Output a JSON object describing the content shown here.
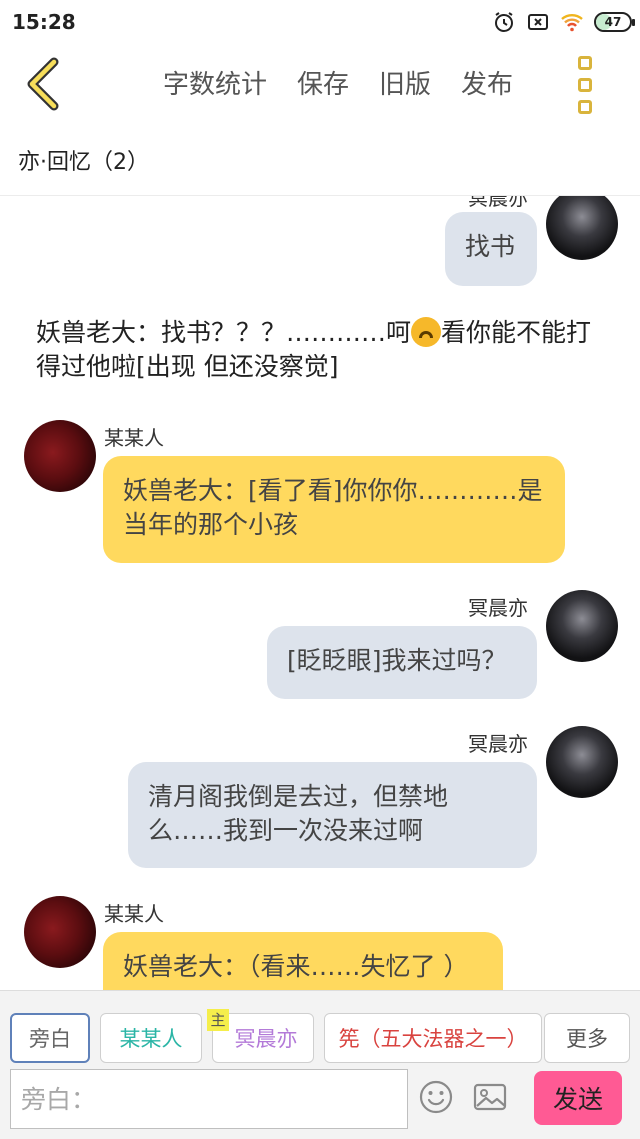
{
  "status_bar": {
    "time": "15:28",
    "battery": "47",
    "battery_level_percent": 47
  },
  "top_bar": {
    "menu": [
      "字数统计",
      "保存",
      "旧版",
      "发布"
    ]
  },
  "story_title": "亦·回忆（2）",
  "chat": {
    "partial_name_top": "冥晨亦",
    "msg1": "找书",
    "narration_part1": "妖兽老大：找书？？？…………呵",
    "narration_part2": "看你能不能打得过他啦[出现 但还没察觉]",
    "msg2_name": "某某人",
    "msg2": "妖兽老大：[看了看]你你你…………是当年的那个小孩",
    "msg3_name": "冥晨亦",
    "msg3": "[眨眨眼]我来过吗？",
    "msg4_name": "冥晨亦",
    "msg4": "清月阁我倒是去过，但禁地么……我到一次没来过啊",
    "msg5_name": "某某人",
    "msg5": "妖兽老大：（看来……失忆了 ）"
  },
  "roles": {
    "narrator": "旁白",
    "someone": "某某人",
    "main_badge": "主",
    "main": "冥晨亦",
    "other": "筅（五大法器之一）",
    "more": "更多"
  },
  "composer": {
    "placeholder": "旁白：",
    "send": "发送"
  },
  "colors": {
    "accent_yellow": "#ffd95e",
    "gray_bubble": "#dde3ec",
    "send_pink": "#ff5a94",
    "role_someone": "#2bb5a6",
    "role_main": "#b37ad8",
    "role_other": "#d9433f"
  }
}
